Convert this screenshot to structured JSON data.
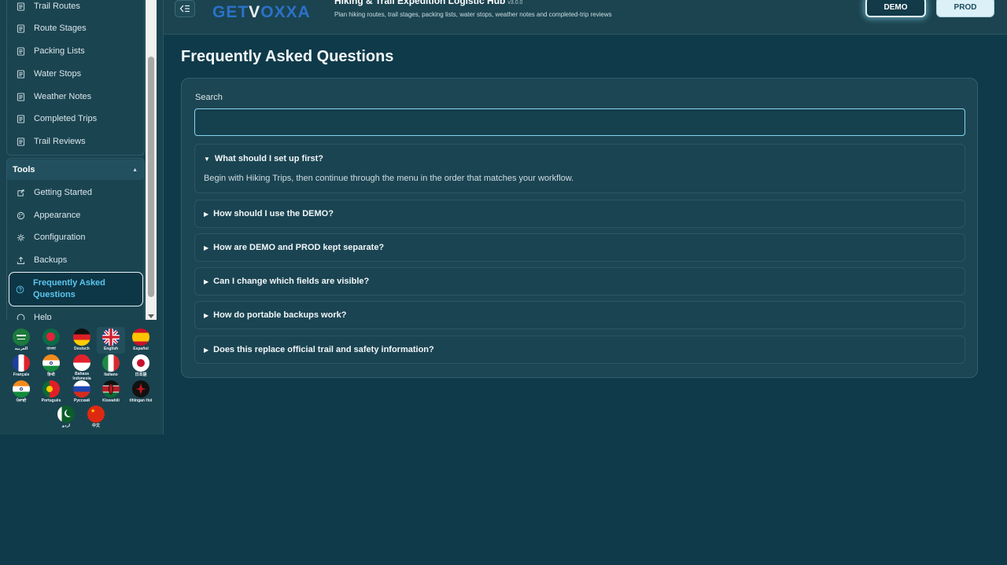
{
  "sidebar": {
    "items": [
      {
        "label": "Trail Routes",
        "icon": "document-icon"
      },
      {
        "label": "Route Stages",
        "icon": "document-icon"
      },
      {
        "label": "Packing Lists",
        "icon": "document-icon"
      },
      {
        "label": "Water Stops",
        "icon": "document-icon"
      },
      {
        "label": "Weather Notes",
        "icon": "document-icon"
      },
      {
        "label": "Completed Trips",
        "icon": "document-icon"
      },
      {
        "label": "Trail Reviews",
        "icon": "document-icon"
      }
    ],
    "tools_group": {
      "title": "Tools",
      "items": [
        {
          "label": "Getting Started",
          "icon": "launch-icon"
        },
        {
          "label": "Appearance",
          "icon": "palette-icon"
        },
        {
          "label": "Configuration",
          "icon": "gear-icon"
        },
        {
          "label": "Backups",
          "icon": "upload-icon"
        },
        {
          "label": "Frequently Asked Questions",
          "icon": "help-circle-icon",
          "active": true
        },
        {
          "label": "Help",
          "icon": "help-icon"
        }
      ]
    }
  },
  "languages": [
    {
      "name": "العربية",
      "flag": "sa"
    },
    {
      "name": "বাংলা",
      "flag": "bd"
    },
    {
      "name": "Deutsch",
      "flag": "de"
    },
    {
      "name": "English",
      "flag": "gb",
      "selected": true
    },
    {
      "name": "Español",
      "flag": "es"
    },
    {
      "name": "Français",
      "flag": "fr"
    },
    {
      "name": "हिन्दी",
      "flag": "in"
    },
    {
      "name": "Bahasa Indonesia",
      "flag": "id"
    },
    {
      "name": "Italiano",
      "flag": "it"
    },
    {
      "name": "日本語",
      "flag": "jp"
    },
    {
      "name": "ਪੰਜਾਬੀ",
      "flag": "in"
    },
    {
      "name": "Português",
      "flag": "pt"
    },
    {
      "name": "Русский",
      "flag": "ru"
    },
    {
      "name": "Kiswahili",
      "flag": "ke"
    },
    {
      "name": "tlhIngan Hol",
      "flag": "klingon"
    },
    {
      "name": "اردو",
      "flag": "pk"
    },
    {
      "name": "中文",
      "flag": "cn"
    }
  ],
  "header": {
    "logo": {
      "part1": "GET",
      "part2": "V",
      "part3": "OXXA"
    },
    "app_title": "Hiking & Trail Expedition Logistic Hub",
    "version": "v3.0.0",
    "subtitle": "Plan hiking routes, trail stages, packing lists, water stops, weather notes and completed-trip reviews",
    "demo_label": "DEMO",
    "prod_label": "PROD"
  },
  "main": {
    "title": "Frequently Asked Questions",
    "search_label": "Search",
    "search_value": "",
    "faqs": [
      {
        "question": "What should I set up first?",
        "answer": "Begin with Hiking Trips, then continue through the menu in the order that matches your workflow.",
        "expanded": true
      },
      {
        "question": "How should I use the DEMO?",
        "expanded": false
      },
      {
        "question": "How are DEMO and PROD kept separate?",
        "expanded": false
      },
      {
        "question": "Can I change which fields are visible?",
        "expanded": false
      },
      {
        "question": "How do portable backups work?",
        "expanded": false
      },
      {
        "question": "Does this replace official trail and safety information?",
        "expanded": false
      }
    ]
  },
  "colors": {
    "background": "#0f3a49",
    "accent": "#5cc6ef",
    "brand": "#2b72c9"
  }
}
